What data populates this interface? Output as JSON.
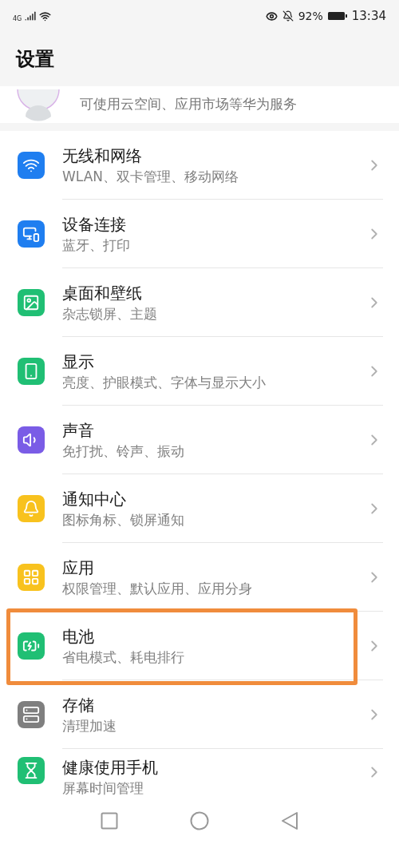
{
  "status_bar": {
    "network": "4G",
    "battery": "92%",
    "time": "13:34"
  },
  "title": "设置",
  "account": {
    "subtitle": "可使用云空间、应用市场等华为服务"
  },
  "items": [
    {
      "title": "无线和网络",
      "subtitle": "WLAN、双卡管理、移动网络",
      "color": "#1f7ef0",
      "highlighted": false
    },
    {
      "title": "设备连接",
      "subtitle": "蓝牙、打印",
      "color": "#1f7ef0",
      "highlighted": false
    },
    {
      "title": "桌面和壁纸",
      "subtitle": "杂志锁屏、主题",
      "color": "#20bf74",
      "highlighted": false
    },
    {
      "title": "显示",
      "subtitle": "亮度、护眼模式、字体与显示大小",
      "color": "#20bf74",
      "highlighted": false
    },
    {
      "title": "声音",
      "subtitle": "免打扰、铃声、振动",
      "color": "#7a5ce6",
      "highlighted": false
    },
    {
      "title": "通知中心",
      "subtitle": "图标角标、锁屏通知",
      "color": "#f8c21e",
      "highlighted": false
    },
    {
      "title": "应用",
      "subtitle": "权限管理、默认应用、应用分身",
      "color": "#f8c21e",
      "highlighted": false
    },
    {
      "title": "电池",
      "subtitle": "省电模式、耗电排行",
      "color": "#20bf74",
      "highlighted": true
    },
    {
      "title": "存储",
      "subtitle": "清理加速",
      "color": "#7f7f7f",
      "highlighted": false
    },
    {
      "title": "健康使用手机",
      "subtitle": "屏幕时间管理",
      "color": "#20bf74",
      "highlighted": false
    }
  ]
}
